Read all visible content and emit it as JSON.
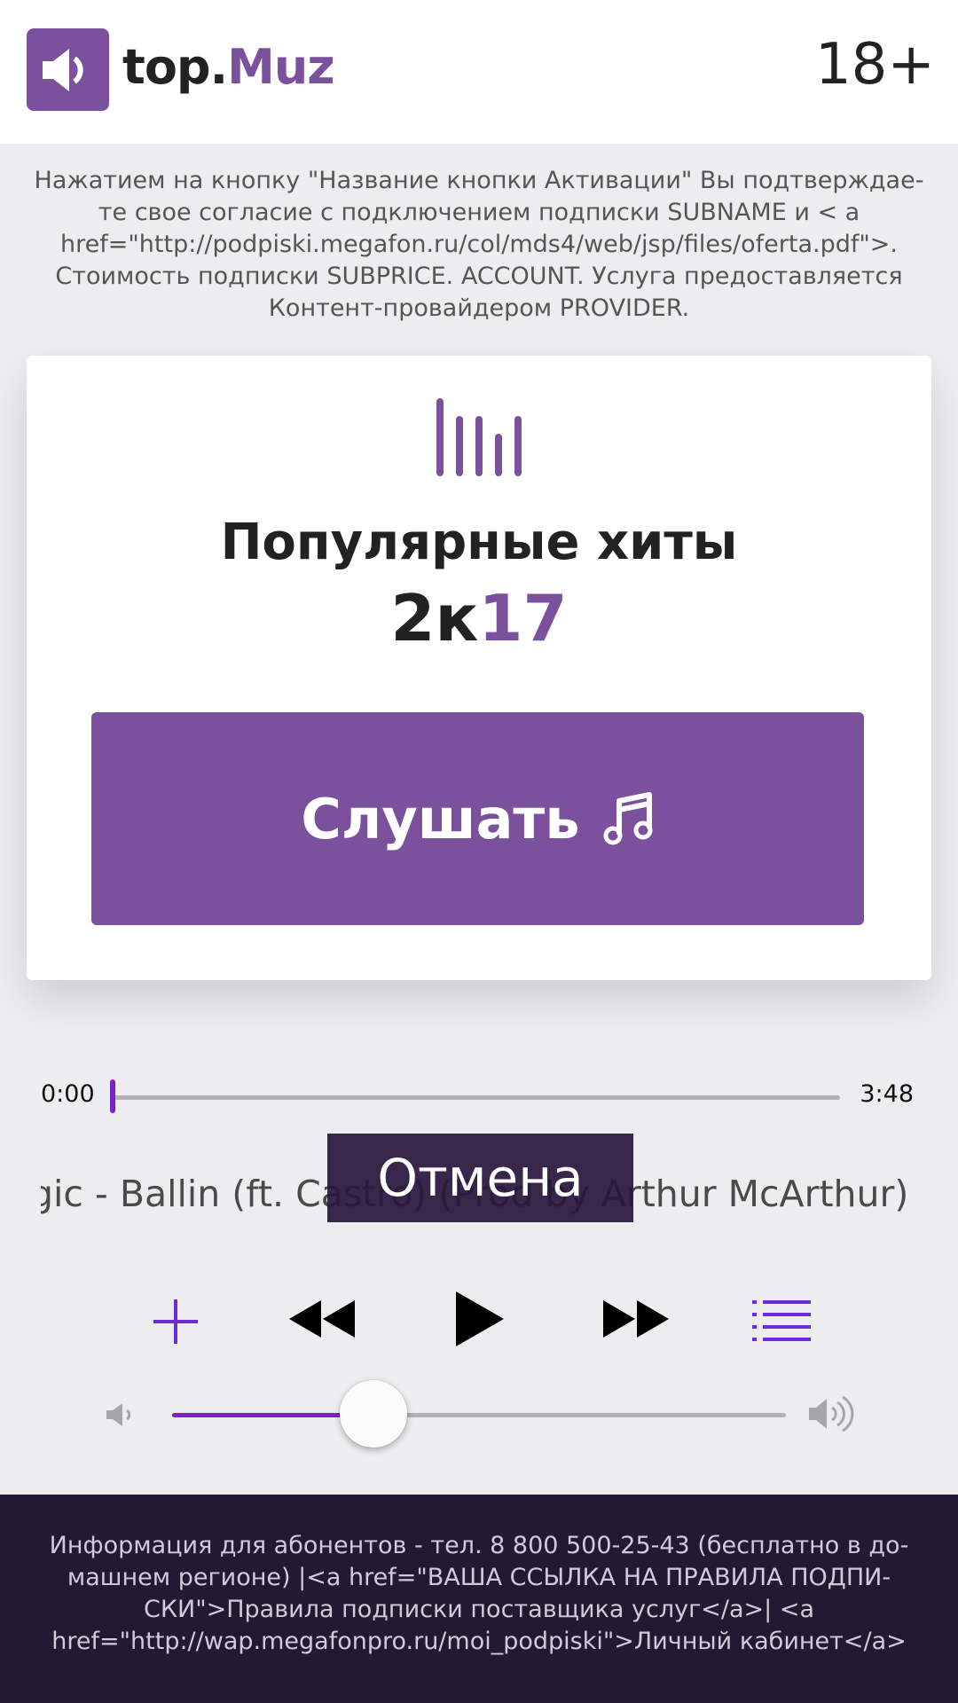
{
  "header": {
    "brand_prefix": "top.",
    "brand_accent": "Muz",
    "age_rating": "18+",
    "logo_icon": "speaker-icon"
  },
  "disclaimer": "Нажатием на кнопку \"Название кнопки Активации\" Вы подтверждае-те свое согласие с подключением подписки SUBNAME и < a href=\"http://podpiski.megafon.ru/col/mds4/web/jsp/files/oferta.pdf\">. Стоимость подписки SUBPRICE. ACCOUNT. Услуга предоставляется Контент-провайдером PROVIDER.",
  "card": {
    "icon": "equalizer-icon",
    "title": "Популярные хиты",
    "year_prefix": "2к",
    "year_accent": "17",
    "listen_label": "Слушать",
    "listen_icon": "music-note-icon"
  },
  "player": {
    "time_current": "0:00",
    "time_total": "3:48",
    "progress": 0.0,
    "track_title": "gic - Ballin (ft. Castro) (Prod by Arthur McArthur) (D",
    "volume": 0.33,
    "buttons": [
      "add-icon",
      "rewind-icon",
      "play-icon",
      "fast-forward-icon",
      "playlist-icon"
    ]
  },
  "toast": {
    "cancel_label": "Отмена"
  },
  "footer": {
    "text": "Информация для абонентов - тел. 8 800 500-25-43 (бесплатно в до-машнем регионе) |<a href=\"ВАША ССЫЛКА НА ПРАВИЛА ПОДПИ-СКИ\">Правила подписки поставщика услуг</a>| <a href=\"http://wap.megafonpro.ru/moi_podpiski\">Личный кабинет</a>"
  },
  "colors": {
    "accent": "#7b519d",
    "progress": "#7a1fd1",
    "footer_bg": "#221a32"
  }
}
